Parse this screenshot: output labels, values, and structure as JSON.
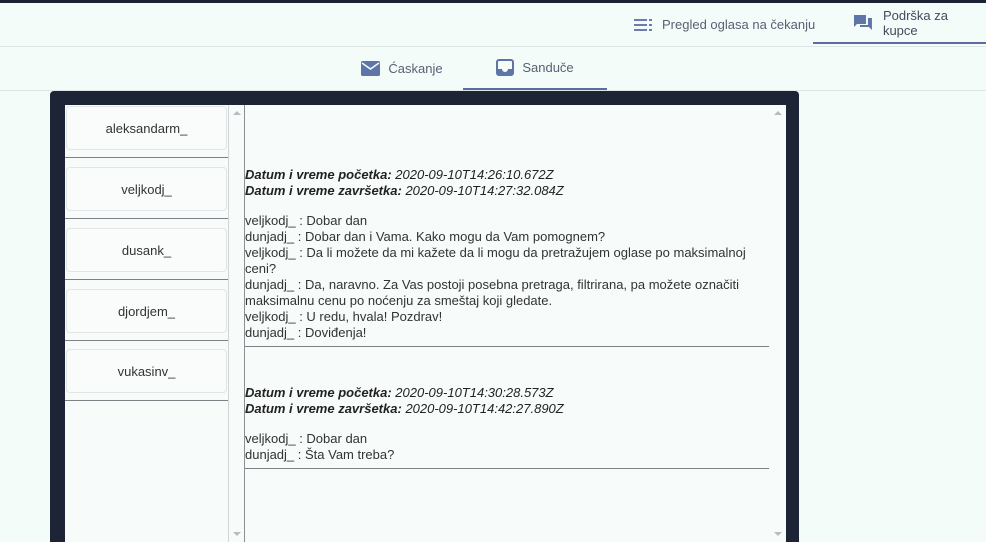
{
  "topnav": {
    "pending": "Pregled oglasa na čekanju",
    "support": "Podrška za kupce"
  },
  "tabs": {
    "chat": "Ćaskanje",
    "inbox": "Sandučе"
  },
  "users": [
    "aleksandarm_",
    "veljkodj_",
    "dusank_",
    "djordjem_",
    "vukasinv_"
  ],
  "conversations": [
    {
      "start_label": "Datum i vreme početka:",
      "start_value": "2020-09-10T14:26:10.672Z",
      "end_label": "Datum i vreme završetka:",
      "end_value": "2020-09-10T14:27:32.084Z",
      "messages": [
        "veljkodj_ : Dobar dan",
        "dunjadj_ : Dobar dan i Vama. Kako mogu da Vam pomognem?",
        "veljkodj_ : Da li možete da mi kažete da li mogu da pretražujem oglase po maksimalnoj ceni?",
        "dunjadj_ : Da, naravno. Za Vas postoji posebna pretraga, filtrirana, pa možete označiti maksimalnu cenu po noćenju za smeštaj koji gledate.",
        "veljkodj_ : U redu, hvala! Pozdrav!",
        "dunjadj_ : Doviđenja!"
      ]
    },
    {
      "start_label": "Datum i vreme početka:",
      "start_value": "2020-09-10T14:30:28.573Z",
      "end_label": "Datum i vreme završetka:",
      "end_value": "2020-09-10T14:42:27.890Z",
      "messages": [
        "veljkodj_ : Dobar dan",
        "dunjadj_ : Šta Vam treba?"
      ]
    }
  ],
  "colors": {
    "background": "#f3fcf8",
    "panel": "#1c2436",
    "accent": "#5d6b9e",
    "icon": "#5f74a8"
  }
}
